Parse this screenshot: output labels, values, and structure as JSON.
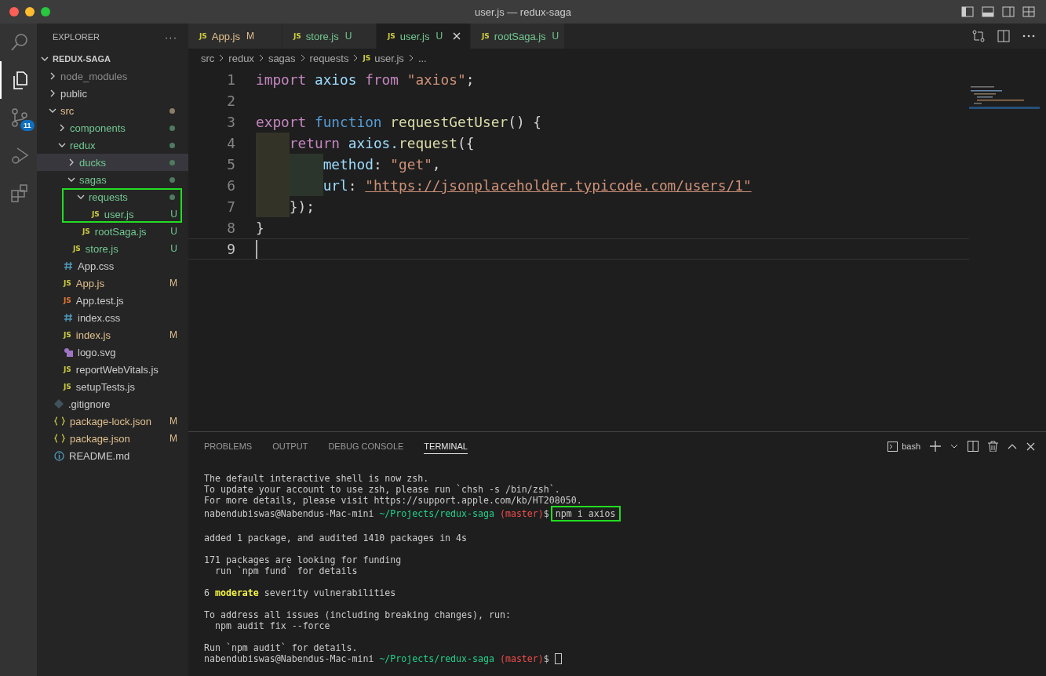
{
  "window": {
    "title": "user.js — redux-saga"
  },
  "activity_bar": [
    {
      "kind": "search",
      "selected": false
    },
    {
      "kind": "files",
      "selected": true
    },
    {
      "kind": "source-control",
      "selected": false,
      "badge": "11"
    },
    {
      "kind": "run",
      "selected": false
    },
    {
      "kind": "extensions",
      "selected": false
    }
  ],
  "explorer": {
    "title": "EXPLORER",
    "more": "···",
    "root": "REDUX-SAGA",
    "expanded": true,
    "children": [
      {
        "name": "node_modules",
        "kind": "folder",
        "expanded": false,
        "selected": false,
        "color": "#8c8c8c"
      },
      {
        "name": "public",
        "kind": "folder",
        "expanded": false,
        "selected": false,
        "color": "#cccccc"
      },
      {
        "name": "src",
        "kind": "folder",
        "expanded": true,
        "selected": false,
        "color": "#e2c08d",
        "dot": {
          "color": "#8a7f66"
        },
        "children": [
          {
            "name": "components",
            "kind": "folder",
            "expanded": false,
            "selected": false,
            "color": "#73c991",
            "dot": {
              "color": "#4f7a5f"
            }
          },
          {
            "name": "redux",
            "kind": "folder",
            "expanded": true,
            "selected": false,
            "color": "#73c991",
            "dot": {
              "color": "#4f7a5f"
            },
            "children": [
              {
                "name": "ducks",
                "kind": "folder",
                "expanded": false,
                "selected": true,
                "color": "#73c991",
                "dot": {
                  "color": "#4f7a5f"
                }
              },
              {
                "name": "sagas",
                "kind": "folder",
                "expanded": true,
                "selected": false,
                "color": "#73c991",
                "dot": {
                  "color": "#4f7a5f"
                },
                "children": [
                  {
                    "name": "requests",
                    "kind": "folder",
                    "expanded": true,
                    "selected": false,
                    "color": "#73c991",
                    "dot": {
                      "color": "#4f7a5f"
                    },
                    "highlighted": true,
                    "children": [
                      {
                        "name": "user.js",
                        "kind": "js",
                        "icon_label": "JS",
                        "selected": false,
                        "color": "#73c991",
                        "badge": "U"
                      }
                    ]
                  },
                  {
                    "name": "rootSaga.js",
                    "kind": "js",
                    "icon_label": "JS",
                    "selected": false,
                    "color": "#73c991",
                    "badge": "U"
                  }
                ]
              },
              {
                "name": "store.js",
                "kind": "js",
                "icon_label": "JS",
                "selected": false,
                "color": "#73c991",
                "badge": "U"
              }
            ]
          },
          {
            "name": "App.css",
            "kind": "css",
            "selected": false,
            "color": "#cccccc"
          },
          {
            "name": "App.js",
            "kind": "js",
            "icon_label": "JS",
            "selected": false,
            "color": "#e2c08d",
            "badge": "M"
          },
          {
            "name": "App.test.js",
            "kind": "test",
            "icon_label": "JS",
            "selected": false,
            "color": "#cccccc"
          },
          {
            "name": "index.css",
            "kind": "css",
            "selected": false,
            "color": "#cccccc"
          },
          {
            "name": "index.js",
            "kind": "js",
            "icon_label": "JS",
            "selected": false,
            "color": "#e2c08d",
            "badge": "M"
          },
          {
            "name": "logo.svg",
            "kind": "svg",
            "selected": false,
            "color": "#cccccc"
          },
          {
            "name": "reportWebVitals.js",
            "kind": "js",
            "icon_label": "JS",
            "selected": false,
            "color": "#cccccc"
          },
          {
            "name": "setupTests.js",
            "kind": "js",
            "icon_label": "JS",
            "selected": false,
            "color": "#cccccc"
          }
        ]
      },
      {
        "name": ".gitignore",
        "kind": "git",
        "selected": false,
        "color": "#cccccc"
      },
      {
        "name": "package-lock.json",
        "kind": "json",
        "selected": false,
        "color": "#e2c08d",
        "badge": "M"
      },
      {
        "name": "package.json",
        "kind": "json",
        "selected": false,
        "color": "#e2c08d",
        "badge": "M"
      },
      {
        "name": "README.md",
        "kind": "info",
        "selected": false,
        "color": "#cccccc"
      }
    ]
  },
  "tabs": [
    {
      "icon_label": "JS",
      "label": "App.js",
      "badge": "M",
      "color": "#e2c08d",
      "selected": false
    },
    {
      "icon_label": "JS",
      "label": "store.js",
      "badge": "U",
      "color": "#73c991",
      "selected": false
    },
    {
      "icon_label": "JS",
      "label": "user.js",
      "badge": "U",
      "color": "#73c991",
      "selected": true
    },
    {
      "icon_label": "JS",
      "label": "rootSaga.js",
      "badge": "U",
      "color": "#73c991",
      "selected": false
    }
  ],
  "breadcrumb": [
    {
      "text": "src"
    },
    {
      "text": "redux"
    },
    {
      "text": "sagas"
    },
    {
      "text": "requests"
    },
    {
      "icon_label": "JS",
      "text": "user.js"
    },
    {
      "text": "..."
    }
  ],
  "code": [
    {
      "number": "1",
      "tokens": [
        {
          "text": "import ",
          "color": "#c586c0"
        },
        {
          "text": "axios ",
          "color": "#9cdcfe"
        },
        {
          "text": "from ",
          "color": "#c586c0"
        },
        {
          "text": "\"axios\"",
          "color": "#ce9178"
        },
        {
          "text": ";",
          "color": "#d4d4d4"
        }
      ]
    },
    {
      "number": "2"
    },
    {
      "number": "3",
      "tokens": [
        {
          "text": "export ",
          "color": "#c586c0"
        },
        {
          "text": "function ",
          "color": "#569cd6"
        },
        {
          "text": "requestGetUser",
          "color": "#dcdcaa"
        },
        {
          "text": "() {",
          "color": "#d4d4d4"
        }
      ]
    },
    {
      "number": "4",
      "tokens": [
        {
          "text": "    return ",
          "color": "#c586c0"
        },
        {
          "text": "axios.",
          "color": "#9cdcfe"
        },
        {
          "text": "request",
          "color": "#dcdcaa"
        },
        {
          "text": "({",
          "color": "#d4d4d4"
        }
      ]
    },
    {
      "number": "5",
      "tokens": [
        {
          "text": "        method",
          "color": "#9cdcfe"
        },
        {
          "text": ": ",
          "color": "#d4d4d4"
        },
        {
          "text": "\"get\"",
          "color": "#ce9178"
        },
        {
          "text": ",",
          "color": "#d4d4d4"
        }
      ]
    },
    {
      "number": "6",
      "tokens": [
        {
          "text": "        url",
          "color": "#9cdcfe"
        },
        {
          "text": ": ",
          "color": "#d4d4d4"
        },
        {
          "text": "\"https://jsonplaceholder.typicode.com/users/1\"",
          "color": "#ce9178",
          "underline": true
        }
      ]
    },
    {
      "number": "7",
      "tokens": [
        {
          "text": "    });",
          "color": "#d4d4d4"
        }
      ]
    },
    {
      "number": "8",
      "tokens": [
        {
          "text": "}",
          "color": "#d4d4d4"
        }
      ]
    },
    {
      "number": "9",
      "current": true
    }
  ],
  "panel": {
    "tabs": [
      {
        "label": "PROBLEMS",
        "selected": false
      },
      {
        "label": "OUTPUT",
        "selected": false
      },
      {
        "label": "DEBUG CONSOLE",
        "selected": false
      },
      {
        "label": "TERMINAL",
        "selected": true
      }
    ],
    "shell": "bash",
    "terminal": [
      {
        "lines": [
          {
            "segments": [
              {
                "text": "The default interactive shell is now zsh.",
                "color": "#cccccc"
              }
            ]
          },
          {
            "segments": [
              {
                "text": "To update your account to use zsh, please run `chsh -s /bin/zsh`.",
                "color": "#cccccc"
              }
            ]
          },
          {
            "segments": [
              {
                "text": "For more details, please visit https://support.apple.com/kb/HT208050.",
                "color": "#cccccc"
              }
            ]
          },
          {
            "segments": [
              {
                "text": "nabendubiswas@Nabendus-Mac-mini ",
                "color": "#cccccc"
              },
              {
                "text": "~/Projects/redux-saga",
                "color": "#23d18b"
              },
              {
                "text": " (master)",
                "color": "#f14c4c"
              },
              {
                "text": "$",
                "color": "#cccccc"
              },
              {
                "text": "npm i axios",
                "color": "#cccccc",
                "boxed": true
              }
            ]
          }
        ]
      },
      {
        "lines": [
          {
            "segments": [
              {
                "text": "added 1 package, and audited 1410 packages in 4s",
                "color": "#cccccc"
              }
            ]
          }
        ]
      },
      {
        "lines": [
          {
            "segments": [
              {
                "text": "171 packages are looking for funding",
                "color": "#cccccc"
              }
            ]
          },
          {
            "segments": [
              {
                "text": "  run `npm fund` for details",
                "color": "#cccccc"
              }
            ]
          }
        ]
      },
      {
        "lines": [
          {
            "segments": [
              {
                "text": "6 ",
                "color": "#cccccc"
              },
              {
                "text": "moderate",
                "color": "#f5f543",
                "bold": true
              },
              {
                "text": " severity vulnerabilities",
                "color": "#cccccc"
              }
            ]
          }
        ]
      },
      {
        "lines": [
          {
            "segments": [
              {
                "text": "To address all issues (including breaking changes), run:",
                "color": "#cccccc"
              }
            ]
          },
          {
            "segments": [
              {
                "text": "  npm audit fix --force",
                "color": "#cccccc"
              }
            ]
          }
        ]
      },
      {
        "lines": [
          {
            "segments": [
              {
                "text": "Run `npm audit` for details.",
                "color": "#cccccc"
              }
            ]
          },
          {
            "cursor": true,
            "segments": [
              {
                "text": "nabendubiswas@Nabendus-Mac-mini ",
                "color": "#cccccc"
              },
              {
                "text": "~/Projects/redux-saga",
                "color": "#23d18b"
              },
              {
                "text": " (master)",
                "color": "#f14c4c"
              },
              {
                "text": "$",
                "color": "#cccccc"
              }
            ]
          }
        ]
      }
    ]
  }
}
